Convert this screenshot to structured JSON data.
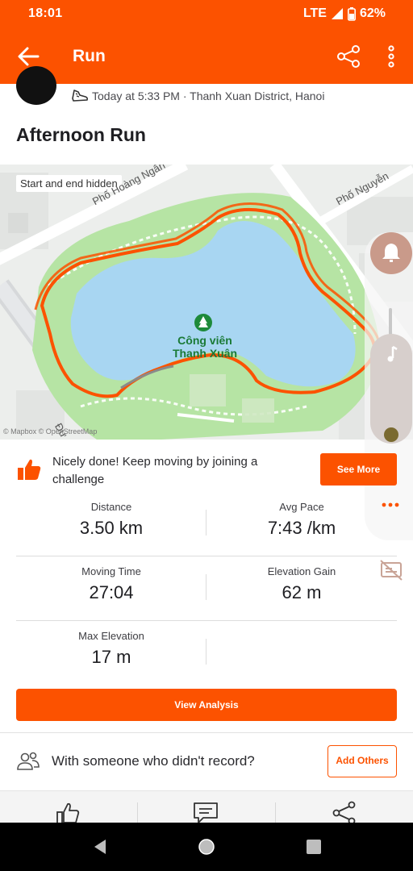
{
  "status_bar": {
    "time": "18:01",
    "network": "LTE",
    "battery": "62%"
  },
  "app_bar": {
    "title": "Run"
  },
  "activity": {
    "timestamp": "Today at 5:33 PM · Thanh Xuan District, Hanoi",
    "title": "Afternoon Run"
  },
  "map": {
    "hidden_label": "Start and end hidden",
    "street_1": "Phố Hoàng Ngân",
    "street_2": "Phố Nguyễn",
    "street_3": "Đư",
    "park_line_1": "Công viên",
    "park_line_2": "Thanh Xuân",
    "attribution": "© Mapbox © OpenStreetMap",
    "route_color": "#fc5200"
  },
  "challenge": {
    "text": "Nicely done! Keep moving by joining a challenge",
    "button": "See More"
  },
  "stats": [
    [
      {
        "label": "Distance",
        "value": "3.50 km"
      },
      {
        "label": "Avg Pace",
        "value": "7:43 /km"
      }
    ],
    [
      {
        "label": "Moving Time",
        "value": "27:04"
      },
      {
        "label": "Elevation Gain",
        "value": "62 m"
      }
    ],
    [
      {
        "label": "Max Elevation",
        "value": "17 m"
      }
    ]
  ],
  "view_analysis": "View Analysis",
  "record_prompt": {
    "text": "With someone who didn't record?",
    "button": "Add Others"
  },
  "colors": {
    "brand": "#fc5200"
  }
}
